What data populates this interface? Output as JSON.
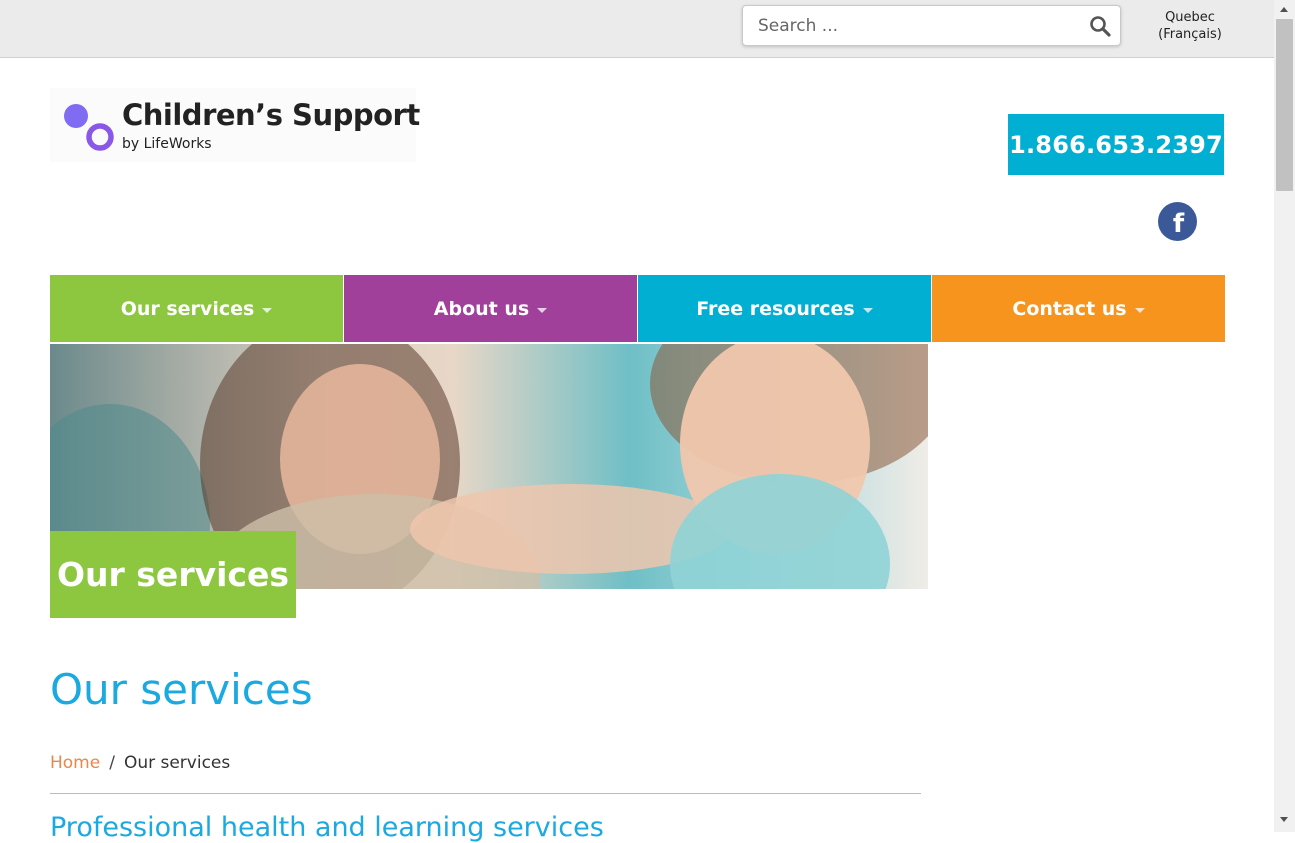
{
  "search": {
    "placeholder": "Search ..."
  },
  "language_link": {
    "line1": "Quebec",
    "line2": "(Français)"
  },
  "logo": {
    "title": "Children’s Support",
    "subtitle": "by LifeWorks"
  },
  "phone": "1.866.653.2397",
  "social": {
    "facebook_glyph": "f"
  },
  "nav": {
    "items": [
      {
        "label": "Our services",
        "color": "#8dc63f"
      },
      {
        "label": "About us",
        "color": "#a0409a"
      },
      {
        "label": "Free resources",
        "color": "#00afd1"
      },
      {
        "label": "Contact us",
        "color": "#f7941e"
      }
    ]
  },
  "hero": {
    "label": "Our services"
  },
  "page": {
    "title": "Our services",
    "breadcrumb": {
      "home": "Home",
      "separator": "/",
      "current": "Our services"
    },
    "subheading": "Professional health and learning services"
  },
  "colors": {
    "accent_blue": "#1aa9e0",
    "link_orange": "#e8874a",
    "facebook": "#3b5998"
  }
}
